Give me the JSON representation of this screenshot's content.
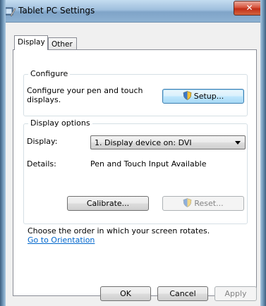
{
  "window": {
    "title": "Tablet PC Settings",
    "close_glyph": "✕"
  },
  "tabs": [
    {
      "label": "Display"
    },
    {
      "label": "Other"
    }
  ],
  "configure": {
    "legend": "Configure",
    "description": "Configure your pen and touch displays.",
    "setup_button": "Setup..."
  },
  "display_options": {
    "legend": "Display options",
    "display_label": "Display:",
    "display_selected": "1. Display device on: DVI",
    "details_label": "Details:",
    "details_value": "Pen and Touch Input Available",
    "calibrate_button": "Calibrate...",
    "reset_button": "Reset..."
  },
  "orientation": {
    "text": "Choose the order in which your screen rotates.",
    "link": "Go to Orientation"
  },
  "footer": {
    "ok": "OK",
    "cancel": "Cancel",
    "apply": "Apply"
  },
  "icons": {
    "app": "tablet-pc-icon",
    "shield": "uac-shield-icon"
  },
  "colors": {
    "link": "#0066cc",
    "close": "#c12e17",
    "primary_border": "#3c7fb1"
  }
}
